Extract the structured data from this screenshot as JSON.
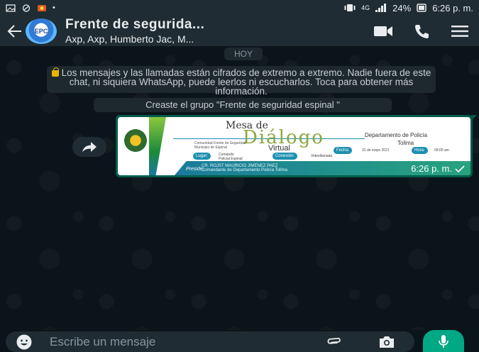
{
  "status_bar": {
    "network": "4G",
    "battery": "24%",
    "time": "6:26 p. m."
  },
  "header": {
    "back_icon": "arrow-left-icon",
    "avatar_text": "EPC",
    "title": "Frente de segurida...",
    "subtitle": "Axp, Axp, Humberto Jac, M...",
    "actions": [
      "video-call-icon",
      "phone-icon",
      "menu-icon"
    ]
  },
  "chat": {
    "date_chip": "HOY",
    "encryption_notice": "Los mensajes y las llamadas están cifrados de extremo a extremo. Nadie fuera de este chat, ni siquiera WhatsApp, puede leerlos ni escucharlos. Toca para obtener más información.",
    "system_message": "Creaste el grupo \"Frente de seguridad espinal \"",
    "image_message": {
      "timestamp": "6:26 p. m.",
      "poster": {
        "title_small": "Mesa de",
        "title_big": "Diálogo",
        "title_sub": "Virtual",
        "community": "Comunidad Frente de Seguridad Municipio de Espinal",
        "department_line1": "Departamento de Policía",
        "department_line2": "Tolima",
        "lugar_label": "Lugar:",
        "lugar_value": "Comando Policial Espinal",
        "conexion_label": "Conexión:",
        "conexion_value": "Videollamada",
        "fecha_label": "Fecha:",
        "fecha_value": "31 de mayo 2021",
        "hora_label": "Hora:",
        "hora_value": "09:00 am",
        "preside_label": "Preside:",
        "preside_line1": "CR. ROJST MAURICIO JIMENEZ PAEZ",
        "preside_line2": "Comandante de Departamento Policía Tolima"
      }
    }
  },
  "composer": {
    "placeholder": "Escribe un mensaje"
  },
  "colors": {
    "header_bg": "#1f2c34",
    "chat_bg": "#0b141a",
    "outgoing_bubble": "#005c4b",
    "accent": "#00a884"
  }
}
